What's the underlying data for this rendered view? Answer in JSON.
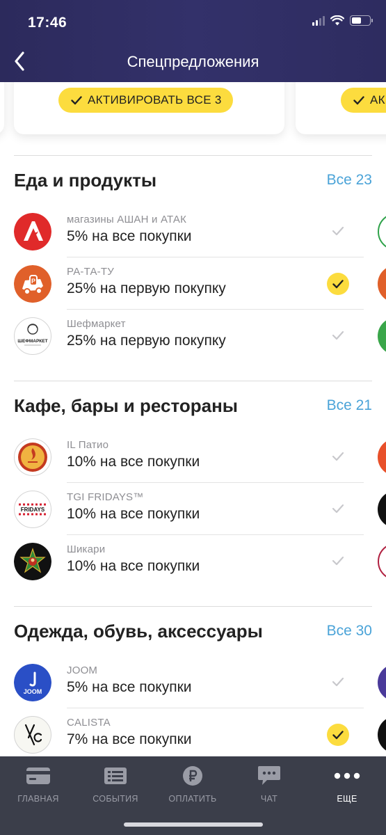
{
  "status_bar": {
    "time": "17:46"
  },
  "nav": {
    "title": "Спецпредложения"
  },
  "offers_banner": {
    "activate_label": "АКТИВИРОВАТЬ ВСЕ 3",
    "peek_label": "АК"
  },
  "sections": [
    {
      "title": "Еда и продукты",
      "see_all": "Все 23",
      "items": [
        {
          "name": "магазины АШАН и АТАК",
          "offer": "5% на все покупки",
          "status": "not-activated"
        },
        {
          "name": "РА-ТА-ТУ",
          "offer": "25% на первую покупку",
          "status": "activated"
        },
        {
          "name": "Шефмаркет",
          "offer": "25% на первую покупку",
          "status": "not-activated",
          "logo_text": "ШЕФМАРКЕТ"
        }
      ]
    },
    {
      "title": "Кафе, бары и рестораны",
      "see_all": "Все 21",
      "items": [
        {
          "name": "IL Патио",
          "offer": "10% на все покупки",
          "status": "not-activated"
        },
        {
          "name": "TGI FRIDAYS™",
          "offer": "10% на все покупки",
          "status": "not-activated",
          "logo_text": "FRIDAYS"
        },
        {
          "name": "Шикари",
          "offer": "10% на все покупки",
          "status": "not-activated"
        }
      ]
    },
    {
      "title": "Одежда, обувь, аксессуары",
      "see_all": "Все 30",
      "items": [
        {
          "name": "JOOM",
          "offer": "5% на все покупки",
          "status": "not-activated",
          "logo_text": "JOOM"
        },
        {
          "name": "CALISTA",
          "offer": "7% на все покупки",
          "status": "activated"
        }
      ]
    }
  ],
  "tabbar": {
    "tabs": [
      {
        "label": "ГЛАВНАЯ",
        "icon": "card-icon"
      },
      {
        "label": "СОБЫТИЯ",
        "icon": "list-icon"
      },
      {
        "label": "ОПЛАТИТЬ",
        "icon": "ruble-icon"
      },
      {
        "label": "ЧАТ",
        "icon": "chat-icon"
      },
      {
        "label": "ЕЩЕ",
        "icon": "more-icon",
        "active": true
      }
    ]
  },
  "colors": {
    "accent_yellow": "#fcdc3e",
    "link_blue": "#4aa3d8",
    "header": "#2c2a5c",
    "tabbar": "#3b3e4a"
  }
}
